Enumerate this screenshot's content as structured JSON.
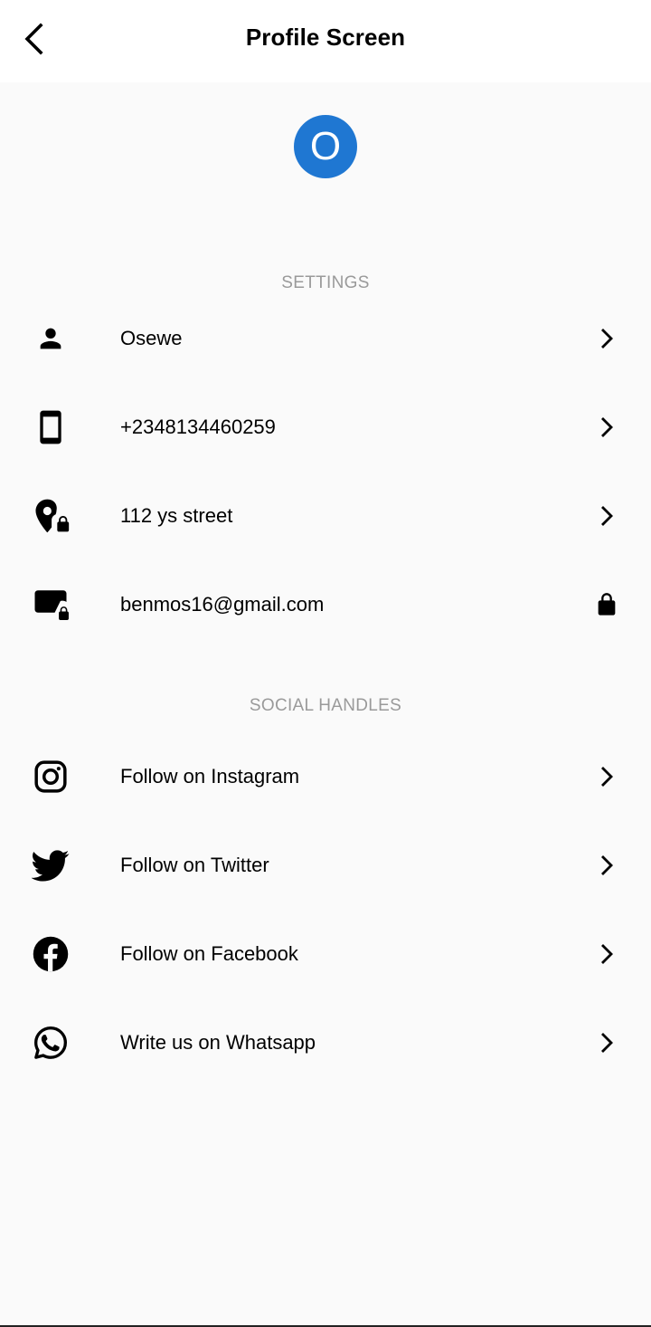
{
  "appbar": {
    "title": "Profile Screen",
    "back_icon": "arrow-back-icon"
  },
  "avatar": {
    "initial": "O",
    "color": "#1f77d2"
  },
  "sections": {
    "settings": {
      "header": "SETTINGS",
      "items": [
        {
          "label": "Osewe",
          "icon": "person-icon",
          "trailing": "chevron-right-icon"
        },
        {
          "label": "+2348134460259",
          "icon": "phone-icon",
          "trailing": "chevron-right-icon"
        },
        {
          "label": "112 ys street",
          "icon": "location-lock-icon",
          "trailing": "chevron-right-icon"
        },
        {
          "label": "benmos16@gmail.com",
          "icon": "email-lock-icon",
          "trailing": "lock-icon"
        }
      ]
    },
    "social": {
      "header": "SOCIAL HANDLES",
      "items": [
        {
          "label": "Follow on Instagram",
          "icon": "instagram-icon",
          "trailing": "chevron-right-icon"
        },
        {
          "label": "Follow on Twitter",
          "icon": "twitter-icon",
          "trailing": "chevron-right-icon"
        },
        {
          "label": "Follow on Facebook",
          "icon": "facebook-icon",
          "trailing": "chevron-right-icon"
        },
        {
          "label": "Write us on Whatsapp",
          "icon": "whatsapp-icon",
          "trailing": "chevron-right-icon"
        }
      ]
    }
  },
  "colors": {
    "background": "#fafafa",
    "appbar": "#ffffff",
    "section_header": "#9a9a9a",
    "accent": "#1f77d2"
  }
}
